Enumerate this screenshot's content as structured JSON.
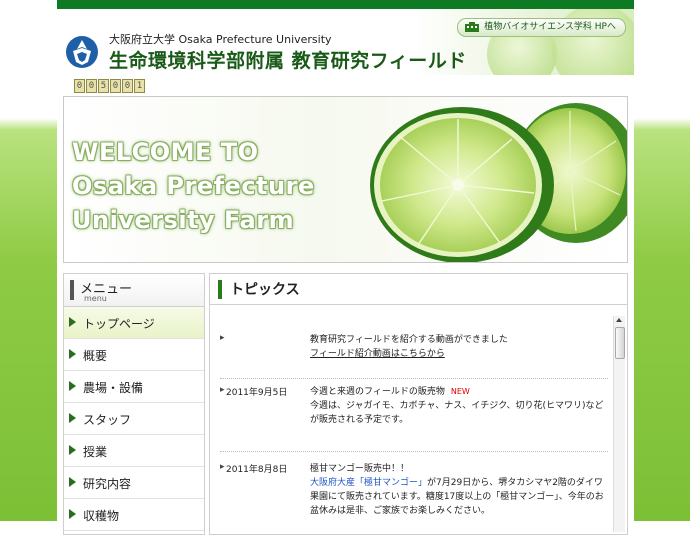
{
  "header": {
    "university": "大阪府立大学 Osaka Prefecture University",
    "title": "生命環境科学部附属 教育研究フィールド",
    "link_label": "植物バイオサイエンス学科 HPへ"
  },
  "counter": [
    "0",
    "0",
    "5",
    "0",
    "0",
    "1"
  ],
  "hero": {
    "lines": [
      "WELCOME TO",
      "Osaka Prefecture",
      "University Farm"
    ]
  },
  "menu": {
    "title": "メニュー",
    "subtitle": "menu",
    "items": [
      {
        "label": "トップページ"
      },
      {
        "label": "概要"
      },
      {
        "label": "農場・設備"
      },
      {
        "label": "スタッフ"
      },
      {
        "label": "授業"
      },
      {
        "label": "研究内容"
      },
      {
        "label": "収穫物"
      }
    ]
  },
  "topics": {
    "title": "トピックス",
    "items": [
      {
        "date": "",
        "line1": "教育研究フィールドを紹介する動画ができました",
        "link": "フィールド紹介動画はこちらから"
      },
      {
        "date": "2011年9月5日",
        "headline": "今週と来週のフィールドの販売物",
        "badge": "NEW",
        "text": "今週は、ジャガイモ、カボチャ、ナス、イチジク、切り花(ヒマワリ)などが販売される予定です。"
      },
      {
        "date": "2011年8月8日",
        "headline": "極甘マンゴー販売中！！",
        "blue_text": "大阪府大産「極甘マンゴー」",
        "text": "が7月29日から、堺タカシマヤ2階のダイワ果園にて販売されています。糖度17度以上の「極甘マンゴー」、今年のお盆休みは是非、ご家族でお楽しみください。"
      }
    ]
  },
  "colors": {
    "brand_green": "#1a5a18",
    "top_bar": "#0f7a24",
    "new_badge": "#e00000",
    "link_blue": "#1f55c4"
  }
}
